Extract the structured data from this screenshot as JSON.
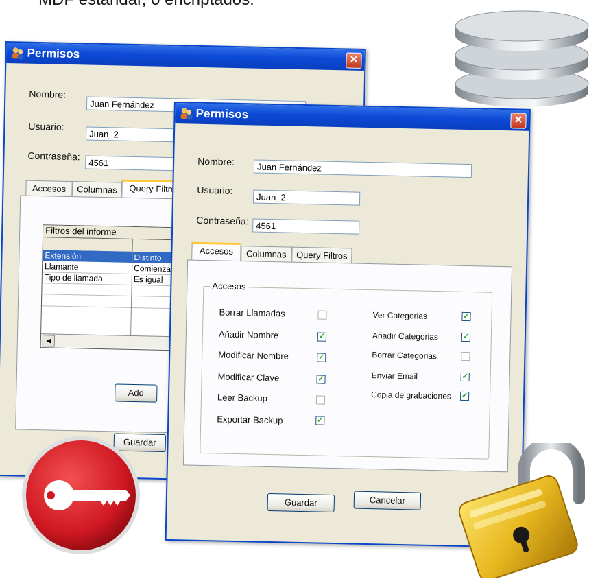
{
  "header_text": "MDF estándar, o encriptados.",
  "back_window": {
    "title": "Permisos",
    "close_glyph": "✕",
    "nombre_label": "Nombre:",
    "nombre_value": "Juan Fernández",
    "usuario_label": "Usuario:",
    "usuario_value": "Juan_2",
    "password_label": "Contraseña:",
    "password_value": "4561",
    "tabs": [
      "Accesos",
      "Columnas",
      "Query Filtros"
    ],
    "grid": {
      "title": "Filtros del informe",
      "rows": [
        {
          "col1": "Extensión",
          "col2": "Distinto"
        },
        {
          "col1": "Llamante",
          "col2": "Comienza"
        },
        {
          "col1": "Tipo de llamada",
          "col2": "Es igual"
        }
      ]
    },
    "add_label": "Add",
    "save_label": "Guardar"
  },
  "front_window": {
    "title": "Permisos",
    "close_glyph": "✕",
    "nombre_label": "Nombre:",
    "nombre_value": "Juan Fernández",
    "usuario_label": "Usuario:",
    "usuario_value": "Juan_2",
    "password_label": "Contraseña:",
    "password_value": "4561",
    "tabs": [
      "Accesos",
      "Columnas",
      "Query Filtros"
    ],
    "group_title": "Accesos",
    "left_perms": [
      {
        "label": "Borrar Llamadas",
        "checked": false
      },
      {
        "label": "Añadir Nombre",
        "checked": true
      },
      {
        "label": "Modificar Nombre",
        "checked": true
      },
      {
        "label": "Modificar Clave",
        "checked": true
      },
      {
        "label": "Leer Backup",
        "checked": false
      },
      {
        "label": "Exportar Backup",
        "checked": true
      }
    ],
    "right_perms": [
      {
        "label": "Ver Categorias",
        "checked": true
      },
      {
        "label": "Añadir Categorias",
        "checked": true
      },
      {
        "label": "Borrar Categorias",
        "checked": false
      },
      {
        "label": "Enviar Email",
        "checked": true
      },
      {
        "label": "Copia de grabaciones",
        "checked": true
      }
    ],
    "save_label": "Guardar",
    "cancel_label": "Cancelar",
    "check_glyph": "✓"
  },
  "colors": {
    "title_blue": "#0a46c8",
    "selection_blue": "#316ac5",
    "key_red": "#d01822",
    "lock_gold": "#e8b820",
    "db_gray": "#a8aeb4"
  }
}
